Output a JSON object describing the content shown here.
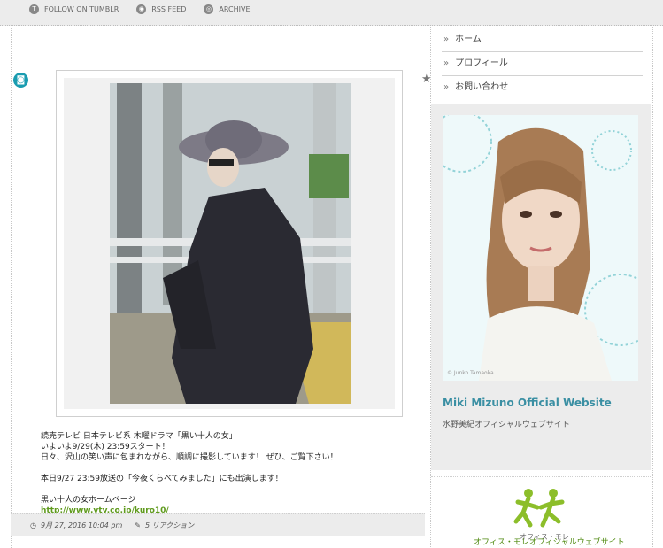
{
  "topbar": {
    "links": [
      {
        "label": "FOLLOW ON TUMBLR",
        "icon": "tumblr-icon"
      },
      {
        "label": "RSS FEED",
        "icon": "rss-icon"
      },
      {
        "label": "ARCHIVE",
        "icon": "archive-icon"
      }
    ]
  },
  "post": {
    "lines": [
      "読売テレビ 日本テレビ系 木曜ドラマ「黒い十人の女」",
      "いよいよ9/29(木) 23:59スタート！",
      "日々、沢山の笑い声に包まれながら、順調に撮影しています！ ぜひ、ご覧下さい！",
      "本日9/27 23:59放送の「今夜くらべてみました」にも出演します！",
      "黒い十人の女ホームページ"
    ],
    "link_text": "http://www.ytv.co.jp/kuro10/",
    "date": "9月 27, 2016 10:04 pm",
    "reactions": "5 リアクション"
  },
  "sidebar": {
    "nav": [
      "ホーム",
      "プロフィール",
      "お問い合わせ"
    ],
    "banner1_title": "Miki Mizuno Official Website",
    "banner1_subtitle": "水野美紀オフィシャルウェブサイト",
    "banner1_photo_credit": "© Junko Tamaoka",
    "banner2_logo_text": "オフィス・モレ",
    "banner2_caption": "オフィス・モレオフィシャルウェブサイト"
  },
  "colors": {
    "accent_teal": "#3a8fa3",
    "link_green": "#5f9a1d",
    "camera_badge": "#1a9cb0"
  }
}
